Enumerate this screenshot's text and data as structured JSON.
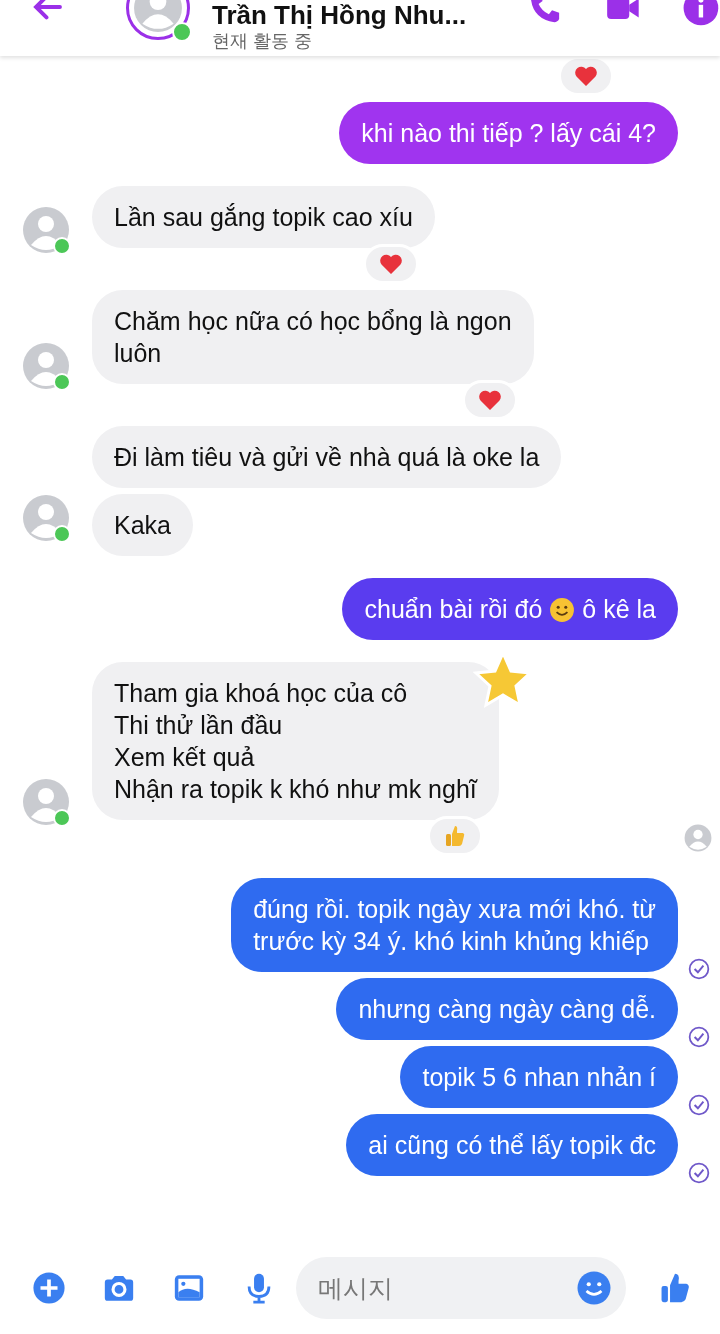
{
  "header": {
    "name": "Trần Thị Hồng Nhu...",
    "status": "현재 활동 중",
    "online": true
  },
  "messages": [
    {
      "kind": "reaction",
      "reaction": {
        "kind": "heart"
      }
    },
    {
      "kind": "outgoing",
      "text": "khi nào thi tiếp ? lấy cái 4?",
      "color": "#a034ef",
      "seen": false
    },
    {
      "kind": "incoming",
      "text": "Lần sau gắng topik cao xíu",
      "avatar": true,
      "reaction": {
        "kind": "heart"
      }
    },
    {
      "kind": "incoming",
      "text": "Chăm học nữa có học bổng là ngon\nluôn",
      "avatar": true,
      "reaction": {
        "kind": "heart"
      }
    },
    {
      "kind": "incoming",
      "text": "Đi làm tiêu và gửi về nhà quá là oke la",
      "avatar": false
    },
    {
      "kind": "incoming",
      "text": "Kaka",
      "avatar": true
    },
    {
      "kind": "outgoing",
      "text": "chuẩn bài rồi đó",
      "emoji": {
        "kind": "smile"
      },
      "text_after": "ô kê la",
      "color": "#5a3cef",
      "seen": false
    },
    {
      "kind": "incoming",
      "text": "Tham gia khoá học của cô\nThi thử lần đầu\nXem kết quả\nNhận ra topik k khó như mk nghĩ",
      "avatar": true,
      "reaction": {
        "kind": "thumbs-up"
      },
      "sticker": true,
      "seen_avatar": true
    },
    {
      "kind": "outgoing",
      "text": "đúng rồi. topik ngày xưa mới khó. từ\ntrước kỳ 34 ý. khó kinh khủng khiếp",
      "color": "#2f6bf0",
      "seen": true
    },
    {
      "kind": "outgoing",
      "text": "nhưng càng ngày càng dễ.",
      "color": "#2f6bf0",
      "seen": true
    },
    {
      "kind": "outgoing",
      "text": "topik 5 6 nhan nhản í",
      "color": "#2f6bf0",
      "seen": true
    },
    {
      "kind": "outgoing",
      "text": "ai cũng có thể lấy topik đc",
      "color": "#2f6bf0",
      "seen": true
    }
  ],
  "composer": {
    "placeholder": "메시지"
  }
}
